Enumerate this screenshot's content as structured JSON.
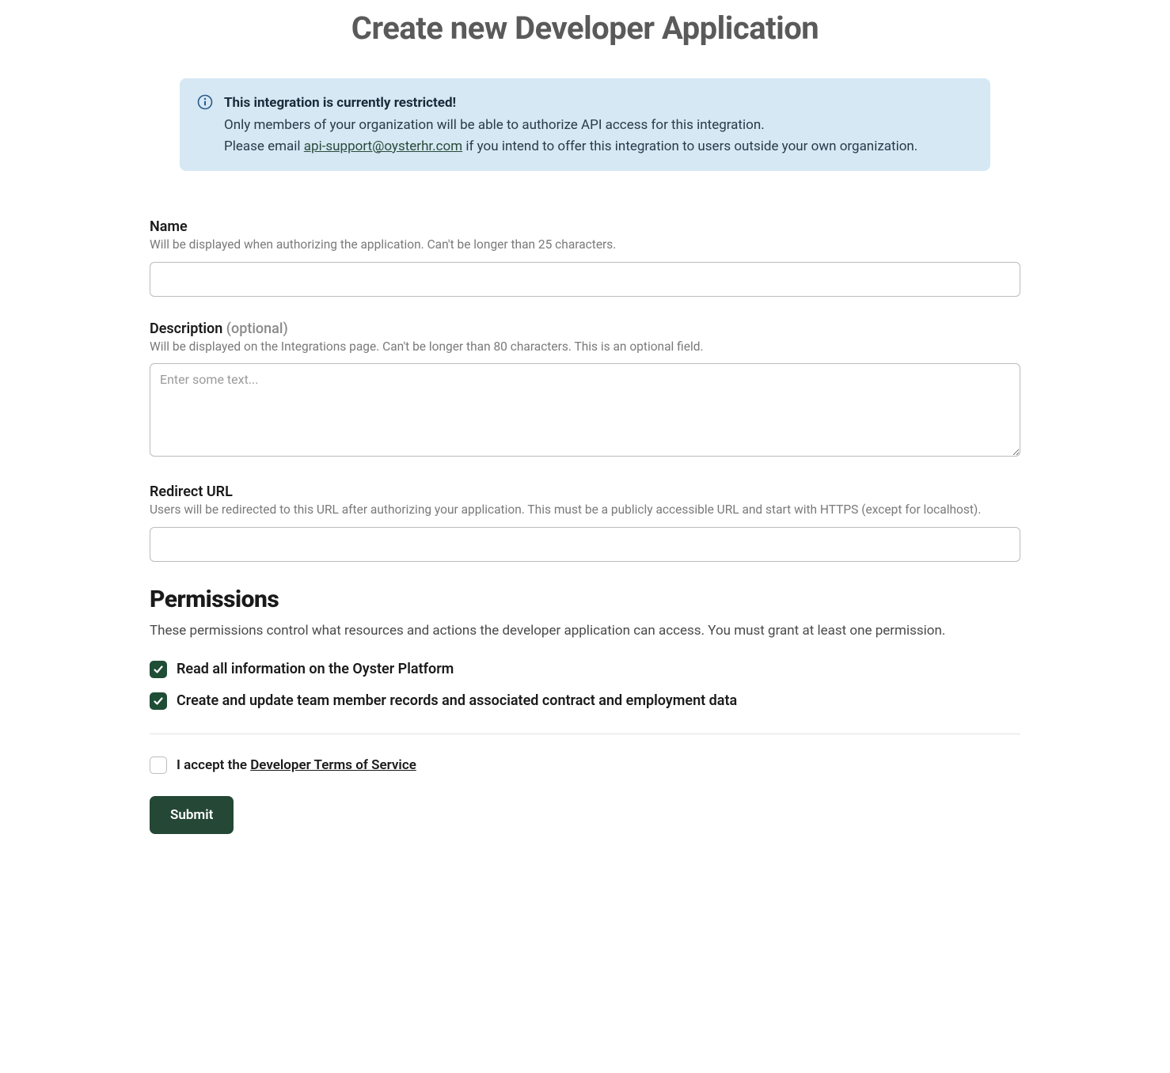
{
  "page_title": "Create new Developer Application",
  "banner": {
    "heading": "This integration is currently restricted!",
    "line1": "Only members of your organization will be able to authorize API access for this integration.",
    "line2_prefix": "Please email ",
    "email": "api-support@oysterhr.com",
    "line2_suffix": " if you intend to offer this integration to users outside your own organization."
  },
  "fields": {
    "name": {
      "label": "Name",
      "help": "Will be displayed when authorizing the application. Can't be longer than 25 characters.",
      "value": ""
    },
    "description": {
      "label": "Description",
      "optional_tag": "(optional)",
      "help": "Will be displayed on the Integrations page. Can't be longer than 80 characters. This is an optional field.",
      "placeholder": "Enter some text...",
      "value": ""
    },
    "redirect_url": {
      "label": "Redirect URL",
      "help": "Users will be redirected to this URL after authorizing your application. This must be a publicly accessible URL and start with HTTPS (except for localhost).",
      "value": ""
    }
  },
  "permissions": {
    "heading": "Permissions",
    "help": "These permissions control what resources and actions the developer application can access. You must grant at least one permission.",
    "items": [
      {
        "label": "Read all information on the Oyster Platform",
        "checked": true
      },
      {
        "label": "Create and update team member records and associated contract and employment data",
        "checked": true
      }
    ]
  },
  "terms": {
    "prefix": "I accept the ",
    "link_text": "Developer Terms of Service",
    "checked": false
  },
  "submit_label": "Submit"
}
